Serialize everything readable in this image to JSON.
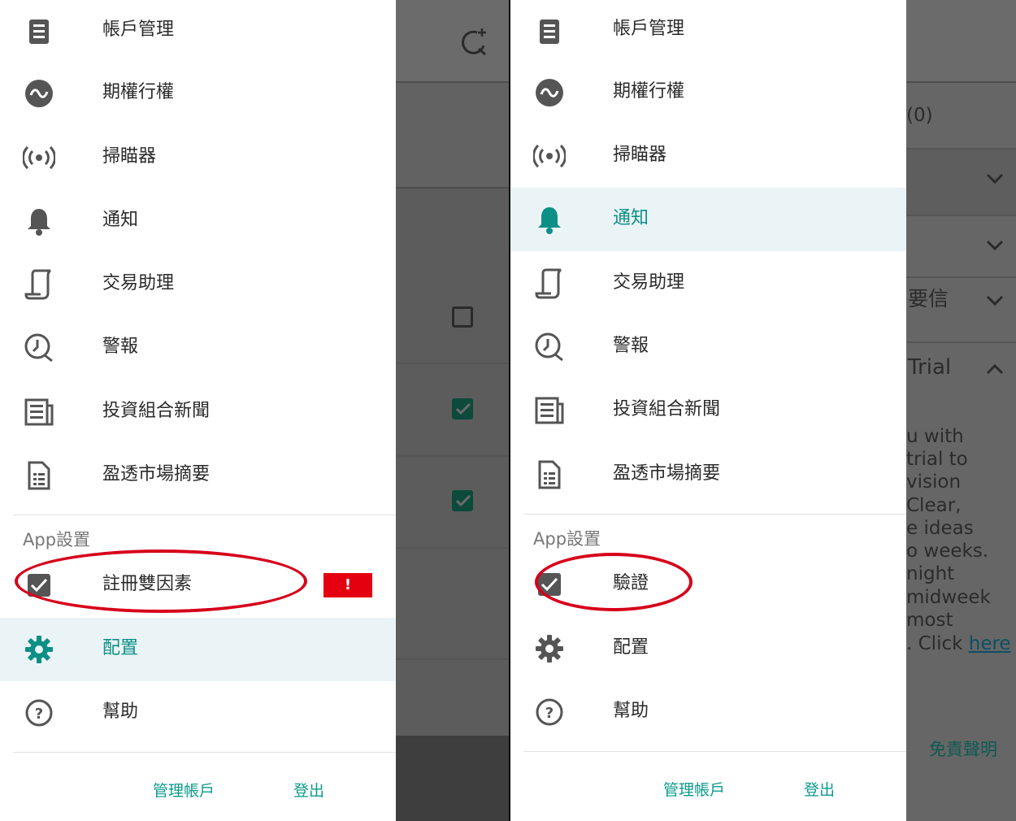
{
  "left_screen": {
    "drawer": {
      "items": [
        {
          "label": "帳戶管理",
          "icon": "document-list-icon"
        },
        {
          "label": "期權行權",
          "icon": "wave-circle-icon"
        },
        {
          "label": "掃瞄器",
          "icon": "broadcast-icon"
        },
        {
          "label": "通知",
          "icon": "bell-icon"
        },
        {
          "label": "交易助理",
          "icon": "scroll-icon"
        },
        {
          "label": "警報",
          "icon": "alarm-icon"
        },
        {
          "label": "投資組合新聞",
          "icon": "newspaper-icon"
        },
        {
          "label": "盈透市場摘要",
          "icon": "report-icon"
        }
      ],
      "app_settings_header": "App設置",
      "settings_items": [
        {
          "label": "註冊雙因素",
          "icon": "checkbox-checked-icon",
          "badge": "!"
        },
        {
          "label": "配置",
          "icon": "gear-icon",
          "active": true
        },
        {
          "label": "幫助",
          "icon": "help-circle-icon"
        }
      ],
      "footer": {
        "manage": "管理帳戶",
        "logout": "登出"
      }
    }
  },
  "right_screen": {
    "drawer": {
      "items": [
        {
          "label": "帳戶管理",
          "icon": "document-list-icon"
        },
        {
          "label": "期權行權",
          "icon": "wave-circle-icon"
        },
        {
          "label": "掃瞄器",
          "icon": "broadcast-icon"
        },
        {
          "label": "通知",
          "icon": "bell-icon",
          "active": true
        },
        {
          "label": "交易助理",
          "icon": "scroll-icon"
        },
        {
          "label": "警報",
          "icon": "alarm-icon"
        },
        {
          "label": "投資組合新聞",
          "icon": "newspaper-icon"
        },
        {
          "label": "盈透市場摘要",
          "icon": "report-icon"
        }
      ],
      "app_settings_header": "App設置",
      "settings_items": [
        {
          "label": "驗證",
          "icon": "checkbox-checked-icon"
        },
        {
          "label": "配置",
          "icon": "gear-icon"
        },
        {
          "label": "幫助",
          "icon": "help-circle-icon"
        }
      ],
      "footer": {
        "manage": "管理帳戶",
        "logout": "登出"
      }
    },
    "background": {
      "count": "(0)",
      "row_text": "要信",
      "trial_heading": "Trial",
      "trial_lines": [
        "u with",
        " trial to",
        " vision",
        " Clear,",
        "e ideas",
        "o weeks.",
        "night",
        "midweek",
        "most",
        ". Click "
      ],
      "trial_link": "here",
      "disclaimer": "免責聲明"
    }
  },
  "colors": {
    "accent": "#0c8f86",
    "alert": "#e4000f",
    "annotation": "#d7001a"
  }
}
